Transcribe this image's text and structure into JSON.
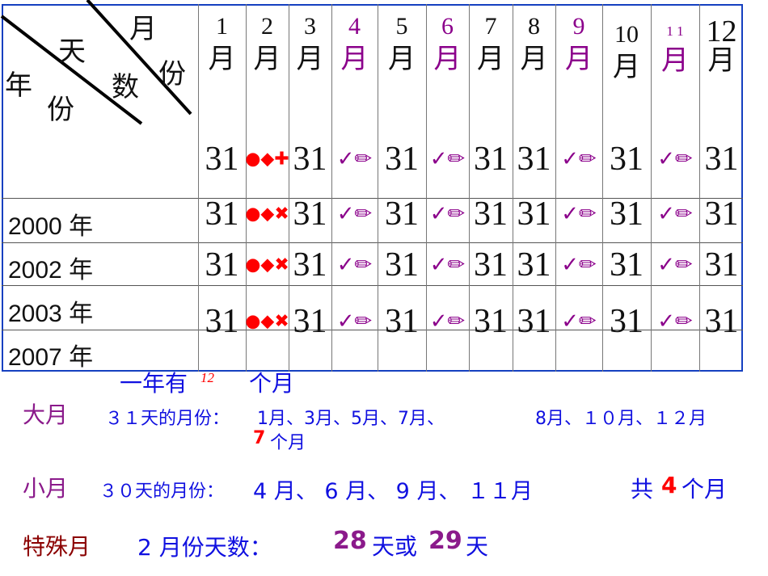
{
  "corner": {
    "year": "年",
    "share": "份",
    "day": "天",
    "count": "数",
    "month": "月",
    "fen": "份"
  },
  "months": [
    {
      "n": "1",
      "m": "月",
      "color": "#111111"
    },
    {
      "n": "2",
      "m": "月",
      "color": "#111111"
    },
    {
      "n": "3",
      "m": "月",
      "color": "#111111"
    },
    {
      "n": "4",
      "m": "月",
      "color": "#8b008b"
    },
    {
      "n": "5",
      "m": "月",
      "color": "#111111"
    },
    {
      "n": "6",
      "m": "月",
      "color": "#8b008b"
    },
    {
      "n": "7",
      "m": "月",
      "color": "#111111"
    },
    {
      "n": "8",
      "m": "月",
      "color": "#111111"
    },
    {
      "n": "9",
      "m": "月",
      "color": "#8b008b"
    },
    {
      "n": "10",
      "m": "月",
      "color": "#111111"
    },
    {
      "n": "1 1",
      "m": "月",
      "color": "#8b008b"
    },
    {
      "n": "12",
      "m": "月",
      "color": "#111111"
    }
  ],
  "years": [
    "2000 年",
    "2002 年",
    "2003 年",
    "2007 年"
  ],
  "rows": [
    [
      "31",
      "feb-plus",
      "31",
      "small",
      "31",
      "small",
      "31",
      "31",
      "small",
      "31",
      "small",
      "31"
    ],
    [
      "31",
      "feb-x",
      "31",
      "small",
      "31",
      "small",
      "31",
      "31",
      "small",
      "31",
      "small",
      "31"
    ],
    [
      "31",
      "feb-x",
      "31",
      "small",
      "31",
      "small",
      "31",
      "31",
      "small",
      "31",
      "small",
      "31"
    ],
    [
      "31",
      "feb-x",
      "31",
      "small",
      "31",
      "small",
      "31",
      "31",
      "small",
      "31",
      "small",
      "31"
    ]
  ],
  "icons": {
    "small": "check-pencil-icon",
    "feb-x": "key-cross-icon",
    "feb-plus": "key-plus-icon"
  },
  "summary": {
    "year_a": "一年有",
    "year_num": "12",
    "year_b": "个月",
    "big_label": "大月",
    "big_desc": "３１天的月份：",
    "big_list1": "1月、3月、5月、7月、",
    "big_list2": "8月、１０月、１２月",
    "big_count_num": "7",
    "big_count_unit": "个月",
    "small_label": "小月",
    "small_desc": "３０天的月份：",
    "small_list": "4 月、 6 月、 9 月、 １１月",
    "small_total_a": "共",
    "small_total_num": "4",
    "small_total_b": "个月",
    "special_label": "特殊月",
    "special_desc": "2 月份天数：",
    "special_a": "28",
    "special_b": "天或",
    "special_c": "29",
    "special_d": "天"
  }
}
